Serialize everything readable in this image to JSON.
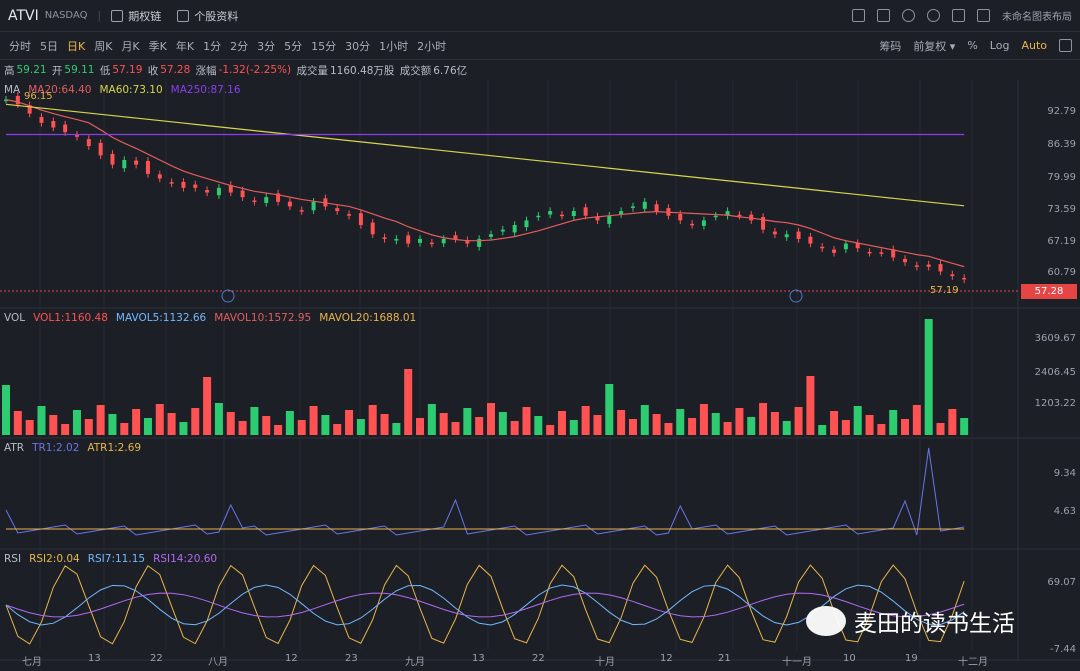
{
  "header": {
    "ticker": "ATVI",
    "exchange": "NASDAQ",
    "options_label": "期权链",
    "profile_label": "个股资料",
    "layout_label": "未命名图表布局"
  },
  "periods": [
    {
      "label": "分时"
    },
    {
      "label": "5日"
    },
    {
      "label": "日K",
      "active": true
    },
    {
      "label": "周K"
    },
    {
      "label": "月K"
    },
    {
      "label": "季K"
    },
    {
      "label": "年K"
    },
    {
      "label": "1分"
    },
    {
      "label": "2分"
    },
    {
      "label": "3分"
    },
    {
      "label": "5分"
    },
    {
      "label": "15分"
    },
    {
      "label": "30分"
    },
    {
      "label": "1小时"
    },
    {
      "label": "2小时"
    }
  ],
  "toolbar_right": [
    "筹码",
    "前复权 ▾",
    "%",
    "Log",
    "Auto"
  ],
  "quote": {
    "high_label": "高",
    "high": "59.21",
    "open_label": "开",
    "open": "59.11",
    "low_label": "低",
    "low": "57.19",
    "close_label": "收",
    "close": "57.28",
    "chg_label": "涨幅",
    "chg": "-1.32(-2.25%)",
    "vol_label": "成交量",
    "vol": "1160.48万股",
    "amt_label": "成交额",
    "amt": "6.76亿"
  },
  "price_legend": {
    "name": "MA",
    "ma20": "MA20:64.40",
    "ma60": "MA60:73.10",
    "ma250": "MA250:87.16",
    "left_val": "96.15"
  },
  "price_axis": [
    "92.79",
    "86.39",
    "79.99",
    "73.59",
    "67.19",
    "60.79"
  ],
  "last_price": "57.28",
  "low_marker": "57.19",
  "event_marker": "财",
  "vol_legend": {
    "name": "VOL",
    "vol1": "VOL1:1160.48",
    "mavol5": "MAVOL5:1132.66",
    "mavol10": "MAVOL10:1572.95",
    "mavol20": "MAVOL20:1688.01"
  },
  "vol_axis": [
    "3609.67",
    "2406.45",
    "1203.22"
  ],
  "atr_legend": {
    "name": "ATR",
    "tr1": "TR1:2.02",
    "atr1": "ATR1:2.69"
  },
  "atr_axis": [
    "9.34",
    "4.63"
  ],
  "rsi_legend": {
    "name": "RSI",
    "rsi2": "RSI2:0.04",
    "rsi7": "RSI7:11.15",
    "rsi14": "RSI14:20.60"
  },
  "rsi_axis": [
    "69.07",
    "-7.44"
  ],
  "x_axis": [
    "七月",
    "13",
    "22",
    "八月",
    "12",
    "23",
    "九月",
    "13",
    "22",
    "十月",
    "12",
    "21",
    "十一月",
    "10",
    "19",
    "十二月"
  ],
  "watermark": "麦田的读书生活",
  "colors": {
    "up": "#2ecc71",
    "down": "#ff5252",
    "ma20": "#e35d5d",
    "ma60": "#d6d64a",
    "ma250": "#8a3ef0",
    "accent": "#e8b64a"
  },
  "chart_data": {
    "type": "candlestick",
    "series_close": [
      96,
      95,
      93,
      91,
      90,
      89,
      88,
      86,
      84,
      82,
      83,
      82,
      80,
      79,
      78,
      77,
      77,
      76,
      77,
      76,
      75,
      74,
      75,
      74,
      73,
      72,
      74,
      73,
      72,
      71,
      69,
      67,
      66,
      66,
      65,
      66,
      65,
      66,
      66,
      65,
      66,
      67,
      68,
      69,
      70,
      71,
      72,
      71,
      72,
      71,
      70,
      71,
      72,
      73,
      74,
      72,
      71,
      70,
      69,
      70,
      71,
      72,
      71,
      70,
      68,
      67,
      67,
      66,
      65,
      64,
      63,
      65,
      64,
      63,
      63,
      62,
      61,
      60,
      60,
      59,
      58,
      57.28
    ]
  }
}
